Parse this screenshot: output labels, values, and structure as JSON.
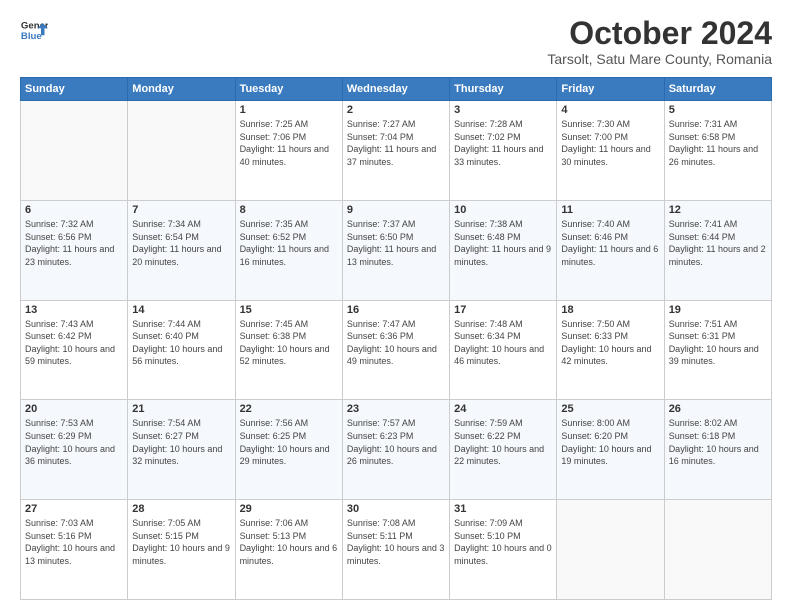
{
  "header": {
    "logo_line1": "General",
    "logo_line2": "Blue",
    "month": "October 2024",
    "location": "Tarsolt, Satu Mare County, Romania"
  },
  "weekdays": [
    "Sunday",
    "Monday",
    "Tuesday",
    "Wednesday",
    "Thursday",
    "Friday",
    "Saturday"
  ],
  "weeks": [
    [
      {
        "day": "",
        "info": ""
      },
      {
        "day": "",
        "info": ""
      },
      {
        "day": "1",
        "info": "Sunrise: 7:25 AM\nSunset: 7:06 PM\nDaylight: 11 hours and 40 minutes."
      },
      {
        "day": "2",
        "info": "Sunrise: 7:27 AM\nSunset: 7:04 PM\nDaylight: 11 hours and 37 minutes."
      },
      {
        "day": "3",
        "info": "Sunrise: 7:28 AM\nSunset: 7:02 PM\nDaylight: 11 hours and 33 minutes."
      },
      {
        "day": "4",
        "info": "Sunrise: 7:30 AM\nSunset: 7:00 PM\nDaylight: 11 hours and 30 minutes."
      },
      {
        "day": "5",
        "info": "Sunrise: 7:31 AM\nSunset: 6:58 PM\nDaylight: 11 hours and 26 minutes."
      }
    ],
    [
      {
        "day": "6",
        "info": "Sunrise: 7:32 AM\nSunset: 6:56 PM\nDaylight: 11 hours and 23 minutes."
      },
      {
        "day": "7",
        "info": "Sunrise: 7:34 AM\nSunset: 6:54 PM\nDaylight: 11 hours and 20 minutes."
      },
      {
        "day": "8",
        "info": "Sunrise: 7:35 AM\nSunset: 6:52 PM\nDaylight: 11 hours and 16 minutes."
      },
      {
        "day": "9",
        "info": "Sunrise: 7:37 AM\nSunset: 6:50 PM\nDaylight: 11 hours and 13 minutes."
      },
      {
        "day": "10",
        "info": "Sunrise: 7:38 AM\nSunset: 6:48 PM\nDaylight: 11 hours and 9 minutes."
      },
      {
        "day": "11",
        "info": "Sunrise: 7:40 AM\nSunset: 6:46 PM\nDaylight: 11 hours and 6 minutes."
      },
      {
        "day": "12",
        "info": "Sunrise: 7:41 AM\nSunset: 6:44 PM\nDaylight: 11 hours and 2 minutes."
      }
    ],
    [
      {
        "day": "13",
        "info": "Sunrise: 7:43 AM\nSunset: 6:42 PM\nDaylight: 10 hours and 59 minutes."
      },
      {
        "day": "14",
        "info": "Sunrise: 7:44 AM\nSunset: 6:40 PM\nDaylight: 10 hours and 56 minutes."
      },
      {
        "day": "15",
        "info": "Sunrise: 7:45 AM\nSunset: 6:38 PM\nDaylight: 10 hours and 52 minutes."
      },
      {
        "day": "16",
        "info": "Sunrise: 7:47 AM\nSunset: 6:36 PM\nDaylight: 10 hours and 49 minutes."
      },
      {
        "day": "17",
        "info": "Sunrise: 7:48 AM\nSunset: 6:34 PM\nDaylight: 10 hours and 46 minutes."
      },
      {
        "day": "18",
        "info": "Sunrise: 7:50 AM\nSunset: 6:33 PM\nDaylight: 10 hours and 42 minutes."
      },
      {
        "day": "19",
        "info": "Sunrise: 7:51 AM\nSunset: 6:31 PM\nDaylight: 10 hours and 39 minutes."
      }
    ],
    [
      {
        "day": "20",
        "info": "Sunrise: 7:53 AM\nSunset: 6:29 PM\nDaylight: 10 hours and 36 minutes."
      },
      {
        "day": "21",
        "info": "Sunrise: 7:54 AM\nSunset: 6:27 PM\nDaylight: 10 hours and 32 minutes."
      },
      {
        "day": "22",
        "info": "Sunrise: 7:56 AM\nSunset: 6:25 PM\nDaylight: 10 hours and 29 minutes."
      },
      {
        "day": "23",
        "info": "Sunrise: 7:57 AM\nSunset: 6:23 PM\nDaylight: 10 hours and 26 minutes."
      },
      {
        "day": "24",
        "info": "Sunrise: 7:59 AM\nSunset: 6:22 PM\nDaylight: 10 hours and 22 minutes."
      },
      {
        "day": "25",
        "info": "Sunrise: 8:00 AM\nSunset: 6:20 PM\nDaylight: 10 hours and 19 minutes."
      },
      {
        "day": "26",
        "info": "Sunrise: 8:02 AM\nSunset: 6:18 PM\nDaylight: 10 hours and 16 minutes."
      }
    ],
    [
      {
        "day": "27",
        "info": "Sunrise: 7:03 AM\nSunset: 5:16 PM\nDaylight: 10 hours and 13 minutes."
      },
      {
        "day": "28",
        "info": "Sunrise: 7:05 AM\nSunset: 5:15 PM\nDaylight: 10 hours and 9 minutes."
      },
      {
        "day": "29",
        "info": "Sunrise: 7:06 AM\nSunset: 5:13 PM\nDaylight: 10 hours and 6 minutes."
      },
      {
        "day": "30",
        "info": "Sunrise: 7:08 AM\nSunset: 5:11 PM\nDaylight: 10 hours and 3 minutes."
      },
      {
        "day": "31",
        "info": "Sunrise: 7:09 AM\nSunset: 5:10 PM\nDaylight: 10 hours and 0 minutes."
      },
      {
        "day": "",
        "info": ""
      },
      {
        "day": "",
        "info": ""
      }
    ]
  ]
}
